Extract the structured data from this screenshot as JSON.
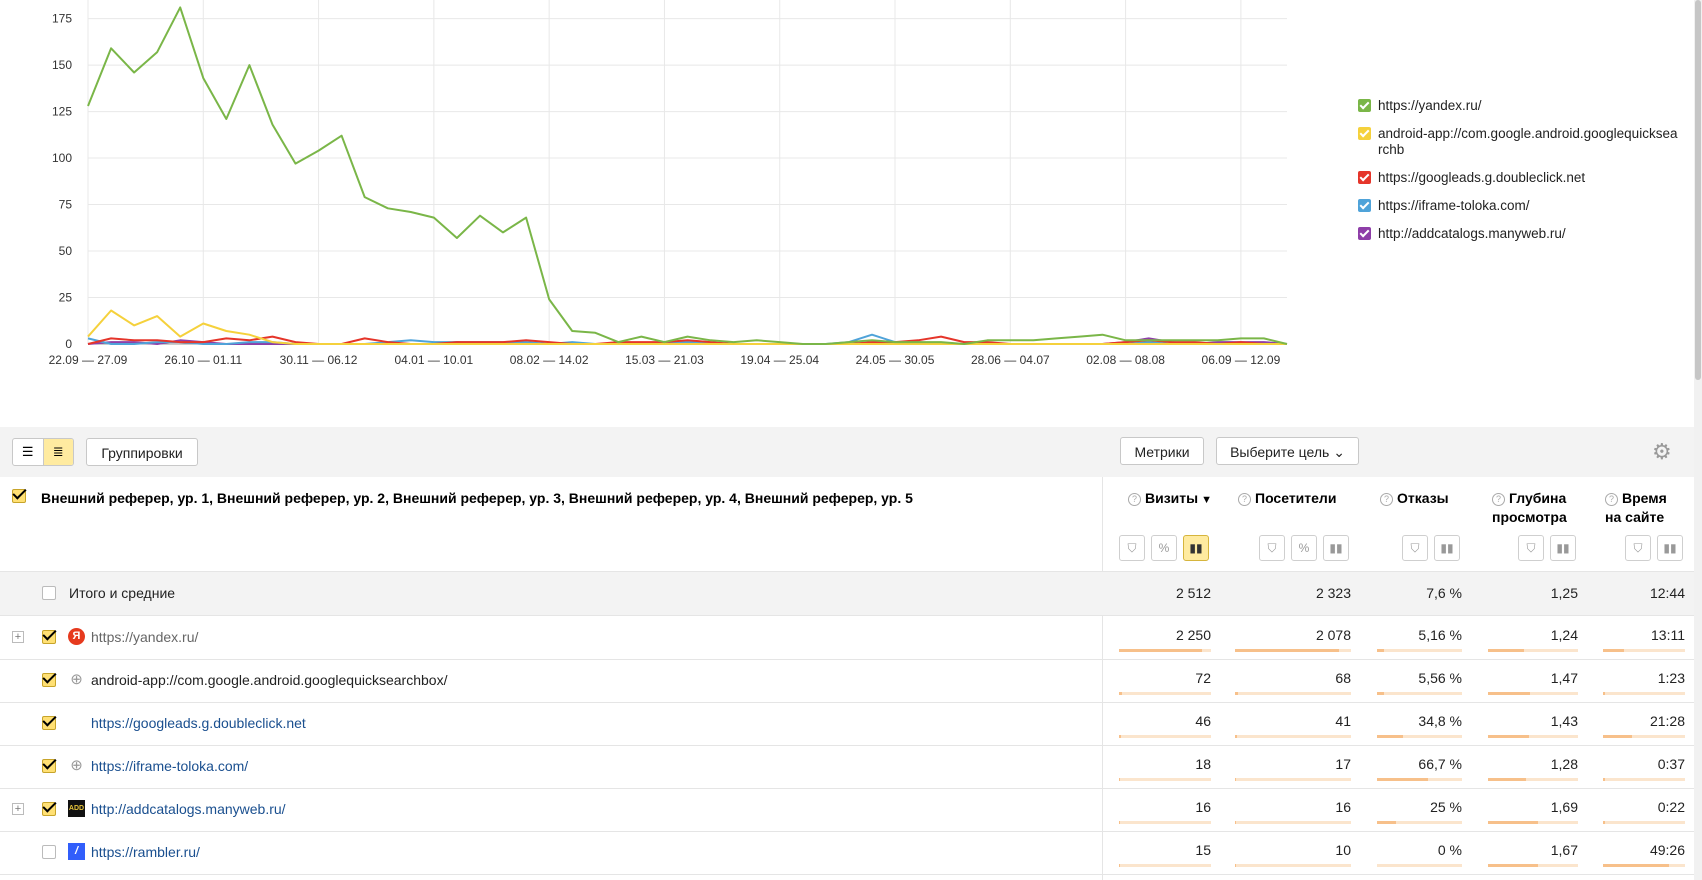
{
  "chart_data": {
    "type": "line",
    "categories": [
      "22.09 — 27.09",
      "",
      "",
      "26.10 — 01.11",
      "",
      "",
      "30.11 — 06.12",
      "",
      "",
      "04.01 — 10.01",
      "",
      "",
      "08.02 — 14.02",
      "",
      "",
      "15.03 — 21.03",
      "",
      "",
      "19.04 — 25.04",
      "",
      "",
      "24.05 — 30.05",
      "",
      "",
      "28.06 — 04.07",
      "",
      "",
      "02.08 — 08.08",
      "",
      "",
      "06.09 — 12.09"
    ],
    "week_count": 52,
    "tick_labels": [
      "22.09 — 27.09",
      "26.10 — 01.11",
      "30.11 — 06.12",
      "04.01 — 10.01",
      "08.02 — 14.02",
      "15.03 — 21.03",
      "19.04 — 25.04",
      "24.05 — 30.05",
      "28.06 — 04.07",
      "02.08 — 08.08",
      "06.09 — 12.09"
    ],
    "y_ticks": [
      "0",
      "25",
      "50",
      "75",
      "100",
      "125",
      "150",
      "175"
    ],
    "ylim": [
      0,
      185
    ],
    "series": [
      {
        "name": "https://yandex.ru/",
        "color": "#7ab648",
        "values": [
          128,
          159,
          146,
          157,
          181,
          143,
          121,
          150,
          118,
          97,
          104,
          112,
          79,
          73,
          71,
          68,
          57,
          69,
          60,
          68,
          24,
          7,
          6,
          1,
          4,
          1,
          4,
          2,
          1,
          2,
          1,
          0,
          0,
          1,
          2,
          1,
          1,
          1,
          0,
          2,
          2,
          2,
          3,
          4,
          5,
          2,
          2,
          2,
          2,
          2,
          3,
          3,
          0
        ]
      },
      {
        "name": "android-app://com.google.android.googlequicksearchbox/",
        "color": "#f5d13c",
        "values": [
          4,
          18,
          10,
          15,
          4,
          11,
          7,
          5,
          1,
          0,
          0,
          0,
          0,
          0,
          0,
          0,
          0,
          0,
          0,
          0,
          0,
          0,
          0,
          0,
          0,
          0,
          0,
          0,
          0,
          0,
          0,
          0,
          0,
          0,
          0,
          0,
          0,
          0,
          0,
          0,
          0,
          0,
          0,
          0,
          0,
          0,
          0,
          0,
          0,
          0,
          0,
          0,
          0
        ]
      },
      {
        "name": "https://googleads.g.doubleclick.net",
        "color": "#e5352a",
        "values": [
          0,
          3,
          2,
          2,
          1,
          1,
          3,
          2,
          4,
          1,
          0,
          0,
          3,
          1,
          0,
          0,
          1,
          1,
          1,
          2,
          1,
          0,
          0,
          1,
          1,
          1,
          2,
          1,
          0,
          0,
          0,
          0,
          0,
          0,
          1,
          1,
          2,
          4,
          1,
          1,
          0,
          0,
          0,
          0,
          0,
          1,
          2,
          1,
          1,
          0,
          1,
          0,
          0
        ]
      },
      {
        "name": "https://iframe-toloka.com/",
        "color": "#4fa3d9",
        "values": [
          3,
          0,
          0,
          1,
          1,
          0,
          0,
          1,
          1,
          0,
          0,
          0,
          0,
          1,
          2,
          1,
          1,
          1,
          1,
          1,
          0,
          1,
          0,
          0,
          0,
          0,
          1,
          0,
          0,
          0,
          0,
          0,
          0,
          1,
          5,
          1,
          0,
          0,
          0,
          0,
          0,
          0,
          0,
          0,
          0,
          0,
          1,
          0,
          0,
          0,
          0,
          0,
          0
        ]
      },
      {
        "name": "http://addcatalogs.manyweb.ru/",
        "color": "#8e3ea8",
        "values": [
          0,
          1,
          1,
          0,
          2,
          1,
          0,
          0,
          0,
          0,
          0,
          0,
          0,
          0,
          0,
          0,
          1,
          0,
          0,
          0,
          0,
          0,
          0,
          0,
          0,
          0,
          1,
          0,
          0,
          0,
          0,
          0,
          0,
          0,
          0,
          0,
          1,
          0,
          0,
          0,
          0,
          0,
          0,
          0,
          0,
          1,
          3,
          1,
          0,
          1,
          1,
          1,
          0
        ]
      }
    ],
    "legend_position": "right",
    "grid": true
  },
  "legend": [
    {
      "label": "https://yandex.ru/",
      "color": "#7ab648"
    },
    {
      "label": "android-app://com.google.android.googlequicksearchb",
      "color": "#f5d13c"
    },
    {
      "label": "https://googleads.g.doubleclick.net",
      "color": "#e5352a"
    },
    {
      "label": "https://iframe-toloka.com/",
      "color": "#4fa3d9"
    },
    {
      "label": "http://addcatalogs.manyweb.ru/",
      "color": "#8e3ea8"
    }
  ],
  "toolbar": {
    "groupings_label": "Группировки",
    "metrics_label": "Метрики",
    "goal_label": "Выберите цель"
  },
  "table": {
    "dimension_title": "Внешний реферер, ур. 1, Внешний реферер, ур. 2, Внешний реферер, ур. 3, Внешний реферер, ур. 4, Внешний реферер, ур. 5",
    "columns": [
      {
        "line1": "Визиты",
        "line2": "",
        "sort": "▼"
      },
      {
        "line1": "Посетители",
        "line2": ""
      },
      {
        "line1": "Отказы",
        "line2": ""
      },
      {
        "line1": "Глубина",
        "line2": "просмотра"
      },
      {
        "line1": "Время",
        "line2": "на сайте"
      }
    ],
    "total": {
      "label": "Итого и средние",
      "values": [
        "2 512",
        "2 323",
        "7,6 %",
        "1,25",
        "12:44"
      ]
    },
    "rows": [
      {
        "label": "https://yandex.ru/",
        "values": [
          "2 250",
          "2 078",
          "5,16 %",
          "1,24",
          "13:11"
        ],
        "levels": [
          0.9,
          0.9,
          0.08,
          0.4,
          0.25
        ],
        "favicon": "yandex-icon",
        "glyph": "Я"
      },
      {
        "label": "android-app://com.google.android.googlequicksearchbox/",
        "values": [
          "72",
          "68",
          "5,56 %",
          "1,47",
          "1:23"
        ],
        "levels": [
          0.03,
          0.03,
          0.08,
          0.47,
          0.03
        ],
        "favicon": "globe-icon",
        "glyph": "⊕"
      },
      {
        "label": "https://googleads.g.doubleclick.net",
        "values": [
          "46",
          "41",
          "34,8 %",
          "1,43",
          "21:28"
        ],
        "levels": [
          0.02,
          0.02,
          0.3,
          0.46,
          0.35
        ],
        "favicon": "none",
        "glyph": ""
      },
      {
        "label": "https://iframe-toloka.com/",
        "values": [
          "18",
          "17",
          "66,7 %",
          "1,28",
          "0:37"
        ],
        "levels": [
          0.01,
          0.01,
          0.6,
          0.42,
          0.02
        ],
        "favicon": "globe-icon",
        "glyph": "⊕"
      },
      {
        "label": "http://addcatalogs.manyweb.ru/",
        "values": [
          "16",
          "16",
          "25 %",
          "1,69",
          "0:22"
        ],
        "levels": [
          0.01,
          0.01,
          0.22,
          0.55,
          0.02
        ],
        "favicon": "addcatalogs-icon",
        "glyph": "ADD"
      },
      {
        "label": "https://rambler.ru/",
        "values": [
          "15",
          "10",
          "0 %",
          "1,67",
          "49:26"
        ],
        "levels": [
          0.01,
          0.01,
          0.0,
          0.55,
          0.8
        ],
        "favicon": "rambler-icon",
        "glyph": "/"
      }
    ]
  }
}
